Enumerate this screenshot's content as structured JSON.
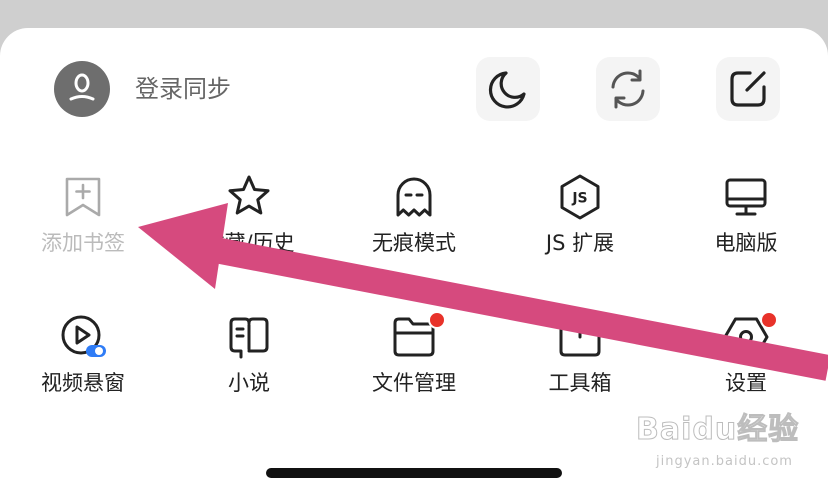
{
  "header": {
    "login_label": "登录同步",
    "buttons": [
      {
        "icon": "moon-icon",
        "label": "night-mode"
      },
      {
        "icon": "sync-icon",
        "label": "sync"
      },
      {
        "icon": "edit-icon",
        "label": "edit"
      }
    ]
  },
  "grid": [
    {
      "label": "添加书签",
      "icon": "bookmark-add-icon",
      "disabled": true
    },
    {
      "label": "收藏/历史",
      "icon": "star-icon"
    },
    {
      "label": "无痕模式",
      "icon": "ghost-icon"
    },
    {
      "label": "JS 扩展",
      "icon": "js-extension-icon"
    },
    {
      "label": "电脑版",
      "icon": "monitor-icon"
    },
    {
      "label": "视频悬窗",
      "icon": "video-float-icon"
    },
    {
      "label": "小说",
      "icon": "book-icon"
    },
    {
      "label": "文件管理",
      "icon": "folder-icon",
      "badge": true
    },
    {
      "label": "工具箱",
      "icon": "toolbox-icon"
    },
    {
      "label": "设置",
      "icon": "settings-icon",
      "badge": true
    }
  ],
  "colors": {
    "arrow": "#d64a7e",
    "badge": "#e8322a",
    "toggle": "#2f7cf6"
  },
  "watermark": {
    "logo": "Baidu经验",
    "url": "jingyan.baidu.com"
  }
}
